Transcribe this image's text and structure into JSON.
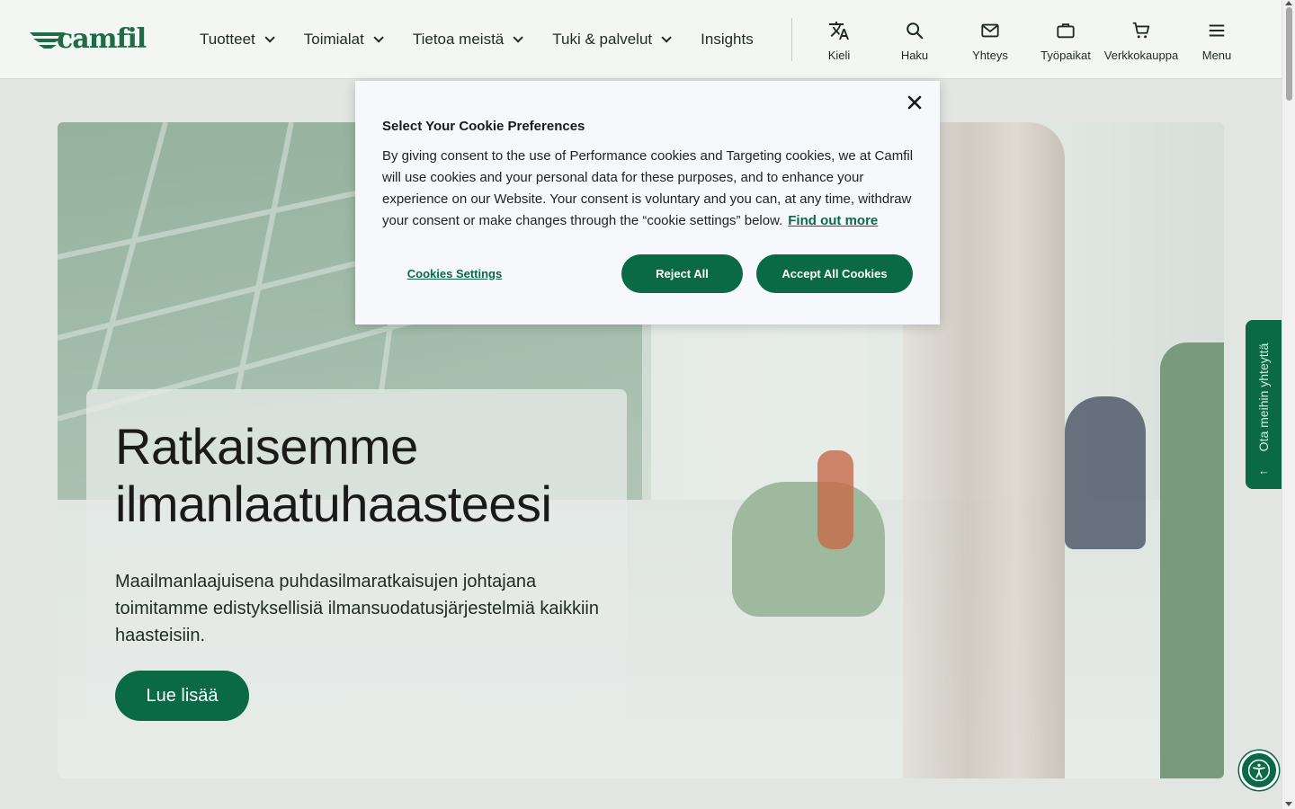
{
  "header": {
    "logo_text": "camfil",
    "nav": [
      {
        "label": "Tuotteet"
      },
      {
        "label": "Toimialat"
      },
      {
        "label": "Tietoa meistä"
      },
      {
        "label": "Tuki & palvelut"
      },
      {
        "label": "Insights"
      }
    ],
    "utilities": [
      {
        "label": "Kieli",
        "icon": "translate-icon"
      },
      {
        "label": "Haku",
        "icon": "search-icon"
      },
      {
        "label": "Yhteys",
        "icon": "mail-icon"
      },
      {
        "label": "Työpaikat",
        "icon": "briefcase-icon"
      },
      {
        "label": "Verkkokauppa",
        "icon": "cart-icon"
      },
      {
        "label": "Menu",
        "icon": "hamburger-icon"
      }
    ]
  },
  "hero": {
    "title": "Ratkaisemme ilmanlaatuhaasteesi",
    "subtitle": "Maailmanlaajuisena puhdasilmaratkaisujen johtajana toimitamme edistyksellisiä ilmansuodatusjärjestelmiä kaikkiin haasteisiin.",
    "button_label": "Lue lisää"
  },
  "side_tab": {
    "label": "Ota meihin yhteyttä",
    "arrow": "←"
  },
  "cookie_modal": {
    "title": "Select Your Cookie Preferences",
    "body": "By giving consent to the use of Performance cookies and Targeting cookies, we at Camfil will use cookies and your personal data for these purposes, and to enhance your experience on our Website. Your consent is voluntary and you can, at any time, withdraw your consent or make changes through the “cookie settings” below.",
    "link_label": "Find out more",
    "settings_label": "Cookies Settings",
    "reject_label": "Reject All",
    "accept_label": "Accept All Cookies"
  },
  "colors": {
    "brand_green": "#0a6a46",
    "header_bg": "#f4f6f4",
    "modal_bg": "#f6f8fb"
  }
}
